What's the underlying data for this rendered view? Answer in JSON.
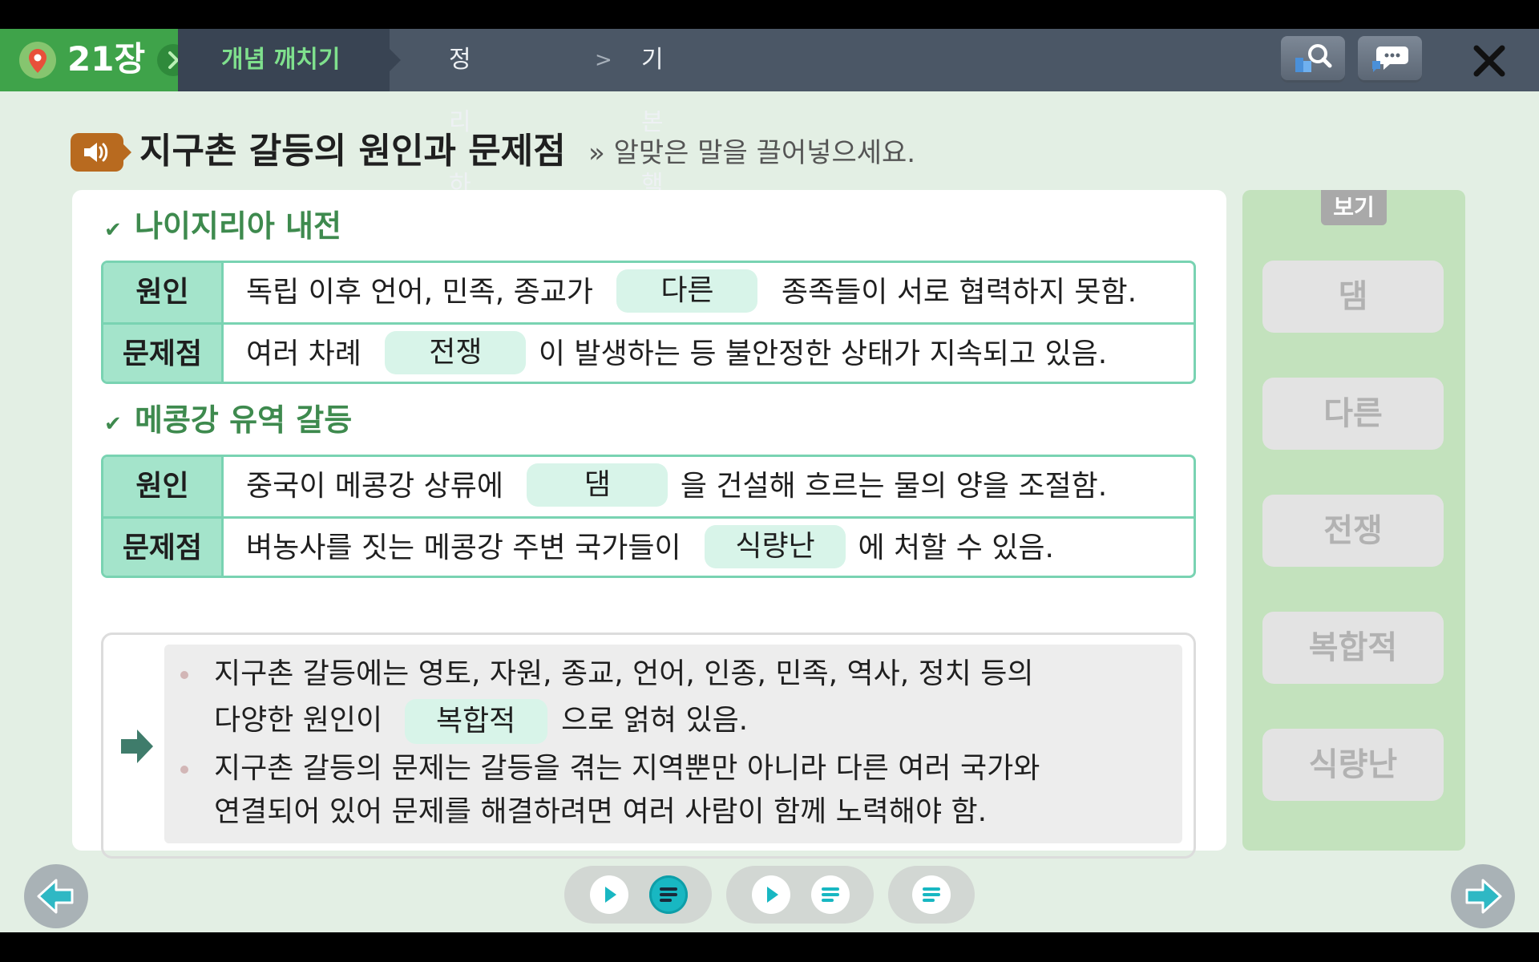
{
  "header": {
    "chapter_label": "21장",
    "tabs": [
      {
        "label": "개념 깨치기",
        "active": true
      },
      {
        "label": "정리하기",
        "active": false
      },
      {
        "label": "기본핵심문제",
        "active": false
      }
    ],
    "separator": ">",
    "icons": [
      "location-icon",
      "chevron-right-icon",
      "search-icon",
      "chat-icon",
      "close-icon"
    ]
  },
  "title": {
    "text": "지구촌 갈등의 원인과 문제점",
    "instruction": "» 알맞은 말을 끌어넣으세요."
  },
  "section1": {
    "title": "나이지리아 내전",
    "rows": [
      {
        "head": "원인",
        "before": "독립 이후 언어, 민족, 종교가",
        "blank": "다른",
        "after": "종족들이 서로 협력하지 못함."
      },
      {
        "head": "문제점",
        "before": "여러 차례",
        "blank": "전쟁",
        "after": "이 발생하는 등 불안정한 상태가 지속되고 있음."
      }
    ]
  },
  "section2": {
    "title": "메콩강 유역 갈등",
    "rows": [
      {
        "head": "원인",
        "before": "중국이 메콩강 상류에",
        "blank": "댐",
        "after": "을 건설해 흐르는 물의 양을 조절함."
      },
      {
        "head": "문제점",
        "before": "벼농사를 짓는 메콩강 주변 국가들이",
        "blank": "식량난",
        "after": "에 처할 수 있음."
      }
    ]
  },
  "summary": {
    "bullet1": {
      "line1": "지구촌 갈등에는 영토, 자원, 종교, 언어, 인종, 민족, 역사, 정치 등의",
      "line2_before": "다양한 원인이",
      "blank": "복합적",
      "line2_after": "으로 얽혀 있음."
    },
    "bullet2": {
      "line1": "지구촌 갈등의 문제는 갈등을 겪는 지역뿐만 아니라 다른 여러 국가와",
      "line2": "연결되어 있어 문제를 해결하려면 여러 사람이 함께 노력해야 함."
    }
  },
  "options": {
    "label": "보기",
    "items": [
      "댐",
      "다른",
      "전쟁",
      "복합적",
      "식량난"
    ]
  },
  "controls": {
    "icons": [
      "play-icon",
      "script-icon",
      "play-icon",
      "script-icon",
      "script-icon"
    ],
    "active_index": 1
  },
  "colors": {
    "accent_green": "#3fa34a",
    "table_border": "#79d3b2",
    "table_head": "#a4e4cb",
    "blank_fill": "#d8f4e9",
    "active_control": "#18b7c2"
  }
}
